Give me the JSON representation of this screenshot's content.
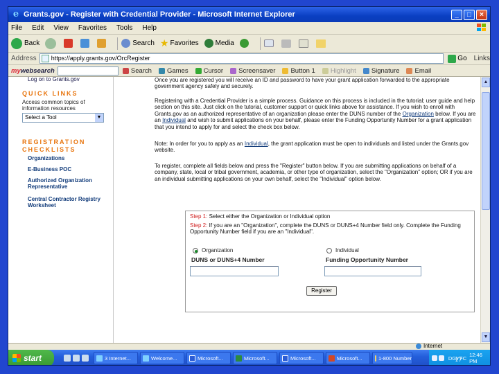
{
  "window": {
    "title": "Grants.gov - Register with Credential Provider - Microsoft Internet Explorer",
    "controls": [
      "_",
      "□",
      "×"
    ]
  },
  "menu": [
    "File",
    "Edit",
    "View",
    "Favorites",
    "Tools",
    "Help"
  ],
  "toolbar": {
    "back": "Back",
    "search": "Search",
    "favorites": "Favorites",
    "media": "Media"
  },
  "address": {
    "label": "Address",
    "url": "https://apply.grants.gov/OrcRegister",
    "go": "Go",
    "links": "Links"
  },
  "searchbar": {
    "brand_my": "my",
    "brand_rest": "websearch",
    "items": [
      "Search",
      "Games",
      "Cursor",
      "Screensaver",
      "Button 1",
      "Highlight",
      "Signature",
      "Email"
    ]
  },
  "sidebar": {
    "login": "Log on to Grants.gov",
    "quick_links_heading": "QUICK LINKS",
    "quick_links_sub": "Access common topics of information resources",
    "select_tool": "Select a Tool",
    "registration_heading_1": "REGISTRATION",
    "registration_heading_2": "CHECKLISTS",
    "links": [
      "Organizations",
      "E-Business POC",
      "Authorized Organization Representative",
      "Central Contractor Registry Worksheet"
    ]
  },
  "main": {
    "para1": "Once you are registered you will receive an ID and password to have your grant application forwarded to the appropriate government agency safely and securely.",
    "para2_a": "Registering with a Credential Provider is a simple process. Guidance on this process is included in the tutorial; user guide and help section on this site. Just click on the tutorial, customer support or quick links above for assistance. If you wish to enroll with Grants.gov as an authorized representative of an organization please enter the DUNS number of the",
    "para2_link1": "Organization",
    "para2_b": "below. If you are an",
    "para2_link2": "Individual",
    "para2_c": "and wish to submit applications on your behalf, please enter the Funding Opportunity Number for a grant application that you intend to apply for and select the check box below.",
    "para3_a": "Note: In order for you to apply as an",
    "para3_link": "Individual",
    "para3_b": ", the grant application must be open to individuals and listed under the Grants.gov website.",
    "para4": "To register, complete all fields below and press the \"Register\" button below. If you are submitting applications on behalf of a company, state, local or tribal government, academia, or other type of organization, select the \"Organization\" option; OR if you are an individual submitting applications on your own behalf, select the \"Individual\" option below."
  },
  "form": {
    "step1_label": "Step 1:",
    "step1_text": "Select either the Organization or Individual option",
    "step2_label": "Step 2:",
    "step2_text": "If you are an \"Organization\", complete the DUNS or DUNS+4 Number field only. Complete the Funding Opportunity Number field if you are an \"Individual\".",
    "option_org": "Organization",
    "option_ind": "Individual",
    "selected": "Organization",
    "duns_label": "DUNS or DUNS+4 Number",
    "fon_label": "Funding Opportunity Number",
    "duns_value": "",
    "fon_value": "",
    "register_button": "Register"
  },
  "status": {
    "zone": "Internet"
  },
  "taskbar": {
    "start": "start",
    "tasks": [
      "3 Internet...",
      "Welcome...",
      "Microsoft...",
      "Microsoft...",
      "Microsoft...",
      "Microsoft...",
      "1-800 Number"
    ],
    "tray_text": "DGYFC",
    "clock": "12:46 PM"
  },
  "slide_number": "17"
}
